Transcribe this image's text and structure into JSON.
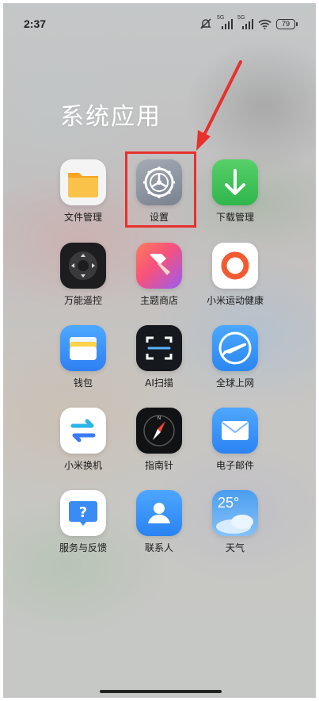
{
  "status_bar": {
    "time": "2:37",
    "signal_1_label": "5G",
    "signal_2_label": "5G",
    "battery": "79"
  },
  "folder": {
    "title": "系统应用"
  },
  "apps": [
    {
      "label": "文件管理",
      "icon": "folder-icon"
    },
    {
      "label": "设置",
      "icon": "gear-icon"
    },
    {
      "label": "下载管理",
      "icon": "download-arrow-icon"
    },
    {
      "label": "万能遥控",
      "icon": "remote-dpad-icon"
    },
    {
      "label": "主题商店",
      "icon": "paintbrush-icon"
    },
    {
      "label": "小米运动健康",
      "icon": "ring-icon"
    },
    {
      "label": "钱包",
      "icon": "wallet-cards-icon"
    },
    {
      "label": "AI扫描",
      "icon": "scan-frame-icon"
    },
    {
      "label": "全球上网",
      "icon": "airplane-icon"
    },
    {
      "label": "小米换机",
      "icon": "transfer-arrows-icon"
    },
    {
      "label": "指南针",
      "icon": "compass-icon"
    },
    {
      "label": "电子邮件",
      "icon": "envelope-icon"
    },
    {
      "label": "服务与反馈",
      "icon": "question-bubble-icon"
    },
    {
      "label": "联系人",
      "icon": "person-icon"
    },
    {
      "label": "天气",
      "icon": "weather-cloud-icon",
      "badge": "25°"
    }
  ],
  "annotation": {
    "arrow_color": "#e8302d",
    "highlight_color": "#e8302d"
  }
}
